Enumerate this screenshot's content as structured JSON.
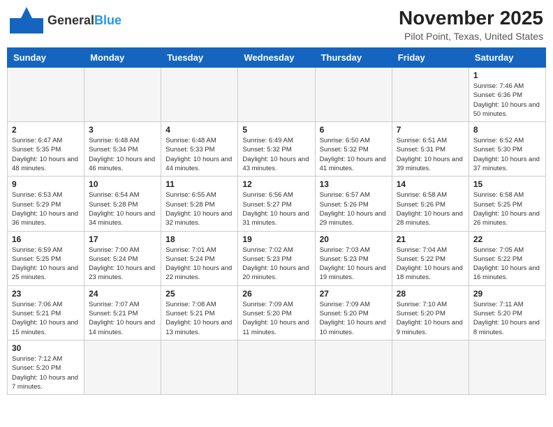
{
  "header": {
    "logo": {
      "part1": "General",
      "part2": "Blue"
    },
    "title": "November 2025",
    "subtitle": "Pilot Point, Texas, United States"
  },
  "weekdays": [
    "Sunday",
    "Monday",
    "Tuesday",
    "Wednesday",
    "Thursday",
    "Friday",
    "Saturday"
  ],
  "weeks": [
    [
      {
        "day": "",
        "empty": true
      },
      {
        "day": "",
        "empty": true
      },
      {
        "day": "",
        "empty": true
      },
      {
        "day": "",
        "empty": true
      },
      {
        "day": "",
        "empty": true
      },
      {
        "day": "",
        "empty": true
      },
      {
        "day": "1",
        "sunrise": "7:46 AM",
        "sunset": "6:36 PM",
        "daylight": "10 hours and 50 minutes."
      }
    ],
    [
      {
        "day": "2",
        "sunrise": "6:47 AM",
        "sunset": "5:35 PM",
        "daylight": "10 hours and 48 minutes."
      },
      {
        "day": "3",
        "sunrise": "6:48 AM",
        "sunset": "5:34 PM",
        "daylight": "10 hours and 46 minutes."
      },
      {
        "day": "4",
        "sunrise": "6:48 AM",
        "sunset": "5:33 PM",
        "daylight": "10 hours and 44 minutes."
      },
      {
        "day": "5",
        "sunrise": "6:49 AM",
        "sunset": "5:32 PM",
        "daylight": "10 hours and 43 minutes."
      },
      {
        "day": "6",
        "sunrise": "6:50 AM",
        "sunset": "5:32 PM",
        "daylight": "10 hours and 41 minutes."
      },
      {
        "day": "7",
        "sunrise": "6:51 AM",
        "sunset": "5:31 PM",
        "daylight": "10 hours and 39 minutes."
      },
      {
        "day": "8",
        "sunrise": "6:52 AM",
        "sunset": "5:30 PM",
        "daylight": "10 hours and 37 minutes."
      }
    ],
    [
      {
        "day": "9",
        "sunrise": "6:53 AM",
        "sunset": "5:29 PM",
        "daylight": "10 hours and 36 minutes."
      },
      {
        "day": "10",
        "sunrise": "6:54 AM",
        "sunset": "5:28 PM",
        "daylight": "10 hours and 34 minutes."
      },
      {
        "day": "11",
        "sunrise": "6:55 AM",
        "sunset": "5:28 PM",
        "daylight": "10 hours and 32 minutes."
      },
      {
        "day": "12",
        "sunrise": "6:56 AM",
        "sunset": "5:27 PM",
        "daylight": "10 hours and 31 minutes."
      },
      {
        "day": "13",
        "sunrise": "6:57 AM",
        "sunset": "5:26 PM",
        "daylight": "10 hours and 29 minutes."
      },
      {
        "day": "14",
        "sunrise": "6:58 AM",
        "sunset": "5:26 PM",
        "daylight": "10 hours and 28 minutes."
      },
      {
        "day": "15",
        "sunrise": "6:58 AM",
        "sunset": "5:25 PM",
        "daylight": "10 hours and 26 minutes."
      }
    ],
    [
      {
        "day": "16",
        "sunrise": "6:59 AM",
        "sunset": "5:25 PM",
        "daylight": "10 hours and 25 minutes."
      },
      {
        "day": "17",
        "sunrise": "7:00 AM",
        "sunset": "5:24 PM",
        "daylight": "10 hours and 23 minutes."
      },
      {
        "day": "18",
        "sunrise": "7:01 AM",
        "sunset": "5:24 PM",
        "daylight": "10 hours and 22 minutes."
      },
      {
        "day": "19",
        "sunrise": "7:02 AM",
        "sunset": "5:23 PM",
        "daylight": "10 hours and 20 minutes."
      },
      {
        "day": "20",
        "sunrise": "7:03 AM",
        "sunset": "5:23 PM",
        "daylight": "10 hours and 19 minutes."
      },
      {
        "day": "21",
        "sunrise": "7:04 AM",
        "sunset": "5:22 PM",
        "daylight": "10 hours and 18 minutes."
      },
      {
        "day": "22",
        "sunrise": "7:05 AM",
        "sunset": "5:22 PM",
        "daylight": "10 hours and 16 minutes."
      }
    ],
    [
      {
        "day": "23",
        "sunrise": "7:06 AM",
        "sunset": "5:21 PM",
        "daylight": "10 hours and 15 minutes."
      },
      {
        "day": "24",
        "sunrise": "7:07 AM",
        "sunset": "5:21 PM",
        "daylight": "10 hours and 14 minutes."
      },
      {
        "day": "25",
        "sunrise": "7:08 AM",
        "sunset": "5:21 PM",
        "daylight": "10 hours and 13 minutes."
      },
      {
        "day": "26",
        "sunrise": "7:09 AM",
        "sunset": "5:20 PM",
        "daylight": "10 hours and 11 minutes."
      },
      {
        "day": "27",
        "sunrise": "7:09 AM",
        "sunset": "5:20 PM",
        "daylight": "10 hours and 10 minutes."
      },
      {
        "day": "28",
        "sunrise": "7:10 AM",
        "sunset": "5:20 PM",
        "daylight": "10 hours and 9 minutes."
      },
      {
        "day": "29",
        "sunrise": "7:11 AM",
        "sunset": "5:20 PM",
        "daylight": "10 hours and 8 minutes."
      }
    ],
    [
      {
        "day": "30",
        "sunrise": "7:12 AM",
        "sunset": "5:20 PM",
        "daylight": "10 hours and 7 minutes."
      },
      {
        "day": "",
        "empty": true
      },
      {
        "day": "",
        "empty": true
      },
      {
        "day": "",
        "empty": true
      },
      {
        "day": "",
        "empty": true
      },
      {
        "day": "",
        "empty": true
      },
      {
        "day": "",
        "empty": true
      }
    ]
  ]
}
